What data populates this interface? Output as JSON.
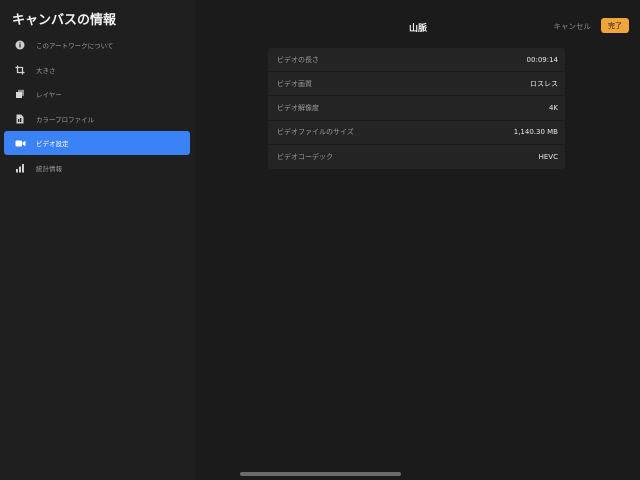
{
  "sidebar": {
    "title": "キャンバスの情報",
    "items": [
      {
        "label": "このアートワークについて",
        "icon": "info-icon",
        "active": false
      },
      {
        "label": "大きさ",
        "icon": "crop-icon",
        "active": false
      },
      {
        "label": "レイヤー",
        "icon": "layers-icon",
        "active": false
      },
      {
        "label": "カラープロファイル",
        "icon": "color-profile-icon",
        "active": false
      },
      {
        "label": "ビデオ設定",
        "icon": "video-camera-icon",
        "active": true
      },
      {
        "label": "統計情報",
        "icon": "bar-chart-icon",
        "active": false
      }
    ]
  },
  "header": {
    "title": "山脈",
    "cancel_label": "キャンセル",
    "done_label": "完了"
  },
  "video_info": [
    {
      "label": "ビデオの長さ",
      "value": "00:09:14"
    },
    {
      "label": "ビデオ画質",
      "value": "ロスレス"
    },
    {
      "label": "ビデオ解像度",
      "value": "4K"
    },
    {
      "label": "ビデオファイルのサイズ",
      "value": "1,140.30 MB"
    },
    {
      "label": "ビデオコーデック",
      "value": "HEVC"
    }
  ],
  "colors": {
    "accent": "#3b82f6",
    "done_button": "#f0a53a",
    "background": "#1b1b1b",
    "row_background": "#242424"
  }
}
